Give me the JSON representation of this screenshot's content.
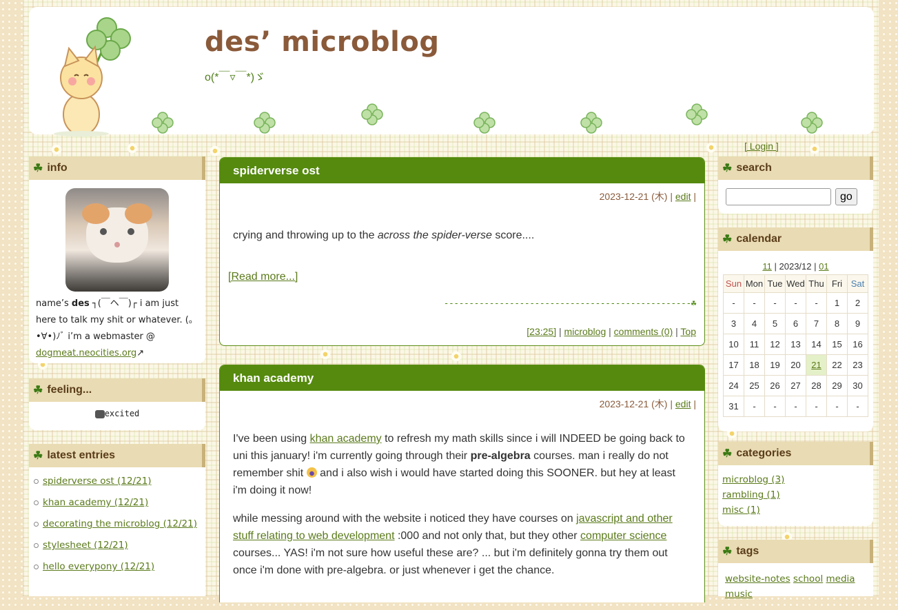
{
  "header": {
    "title": "des’ microblog",
    "subtitle": "o(*￣▿￣*)ゞ"
  },
  "login_label": "[ Login ]",
  "info": {
    "heading": "info",
    "bio_line1_prefix": "name’s ",
    "bio_name": "des",
    "bio_line1_suffix": " ┐(￣ヘ￣)┌ i am just here to talk my shit or whatever. (｡•∀•)ﾉﾞ i’m a webmaster @ ",
    "site_link": "dogmeat.neocities.org",
    "site_link_arrow": "↗"
  },
  "feeling": {
    "heading": "feeling...",
    "status": "excited"
  },
  "latest": {
    "heading": "latest entries",
    "items": [
      "spiderverse ost (12/21)",
      "khan academy (12/21)",
      "decorating the microblog (12/21)",
      "stylesheet (12/21)",
      "hello everypony (12/21)"
    ]
  },
  "posts": [
    {
      "title": "spiderverse ost",
      "date": "2023-12-21 (木)",
      "edit": "edit",
      "body_prefix": "crying and throwing up to the ",
      "body_em": "across the spider-verse",
      "body_suffix": " score....",
      "read_more": "[Read more...]",
      "divider": "-------------------------------------------------",
      "time": "[23:25]",
      "category": "microblog",
      "comments": "comments (0)",
      "top": "Top"
    },
    {
      "title": "khan academy",
      "date": "2023-12-21 (木)",
      "edit": "edit",
      "p1_a": "I've been using ",
      "p1_link": "khan academy",
      "p1_b": " to refresh my math skills since i will INDEED be going back to uni this january! i'm currently going through their ",
      "p1_bold": "pre-algebra",
      "p1_c": " courses. man i really do not remember shit ",
      "p1_d": " and i also wish i would have started doing this SOONER. but hey at least i'm doing it now!",
      "p2_a": "while messing around with the website i noticed they have courses on ",
      "p2_link1": "javascript and other stuff relating to web development",
      "p2_b": " :000 and not only that, but they other ",
      "p2_link2": "computer science",
      "p2_c": " courses... YAS! i'm not sure how useful these are? ... but i'm definitely gonna try them out once i'm done with pre-algebra. or just whenever i get the chance."
    }
  ],
  "search": {
    "heading": "search",
    "placeholder": "",
    "button": "go"
  },
  "calendar": {
    "heading": "calendar",
    "prev": "11",
    "current": "2023/12",
    "next": "01",
    "days": [
      "Sun",
      "Mon",
      "Tue",
      "Wed",
      "Thu",
      "Fri",
      "Sat"
    ],
    "weeks": [
      [
        "-",
        "-",
        "-",
        "-",
        "-",
        "1",
        "2"
      ],
      [
        "3",
        "4",
        "5",
        "6",
        "7",
        "8",
        "9"
      ],
      [
        "10",
        "11",
        "12",
        "13",
        "14",
        "15",
        "16"
      ],
      [
        "17",
        "18",
        "19",
        "20",
        "21",
        "22",
        "23"
      ],
      [
        "24",
        "25",
        "26",
        "27",
        "28",
        "29",
        "30"
      ],
      [
        "31",
        "-",
        "-",
        "-",
        "-",
        "-",
        "-"
      ]
    ],
    "today": "21"
  },
  "categories": {
    "heading": "categories",
    "items": [
      "microblog (3)",
      "rambling (1)",
      "misc (1)"
    ]
  },
  "tags": {
    "heading": "tags",
    "items": [
      "website-notes",
      "school",
      "media",
      "music"
    ]
  },
  "colors": {
    "post_header": "#558a0e",
    "side_header": "#e9dbb3",
    "title_brown": "#8a5a3a",
    "link_green": "#5a7a1a"
  }
}
